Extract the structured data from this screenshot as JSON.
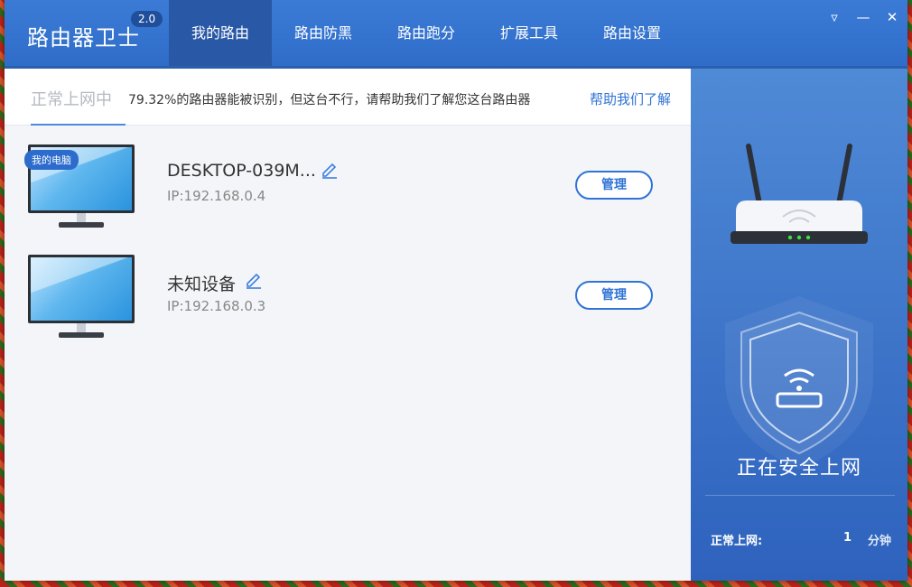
{
  "app": {
    "title": "路由器卫士",
    "version": "2.0"
  },
  "nav": {
    "items": [
      {
        "label": "我的路由",
        "active": true
      },
      {
        "label": "路由防黑",
        "active": false
      },
      {
        "label": "路由跑分",
        "active": false
      },
      {
        "label": "扩展工具",
        "active": false
      },
      {
        "label": "路由设置",
        "active": false
      }
    ]
  },
  "window_controls": {
    "menu": "▿",
    "minimize": "—",
    "close": "✕"
  },
  "status": {
    "state": "正常上网中",
    "message": "79.32%的路由器能被识别，但这台不行，请帮助我们了解您这台路由器",
    "help_link": "帮助我们了解"
  },
  "devices": [
    {
      "tag": "我的电脑",
      "name": "DESKTOP-039M...",
      "ip": "IP:192.168.0.4",
      "manage": "管理"
    },
    {
      "tag": "",
      "name": "未知设备",
      "ip": "IP:192.168.0.3",
      "manage": "管理"
    }
  ],
  "side": {
    "safe_text": "正在安全上网",
    "uptime_label": "正常上网:",
    "uptime_value": "1",
    "uptime_unit": "分钟"
  },
  "colors": {
    "accent": "#2f73d6",
    "titlebar": "#3b7bd6",
    "nav_active": "#2958a6"
  }
}
